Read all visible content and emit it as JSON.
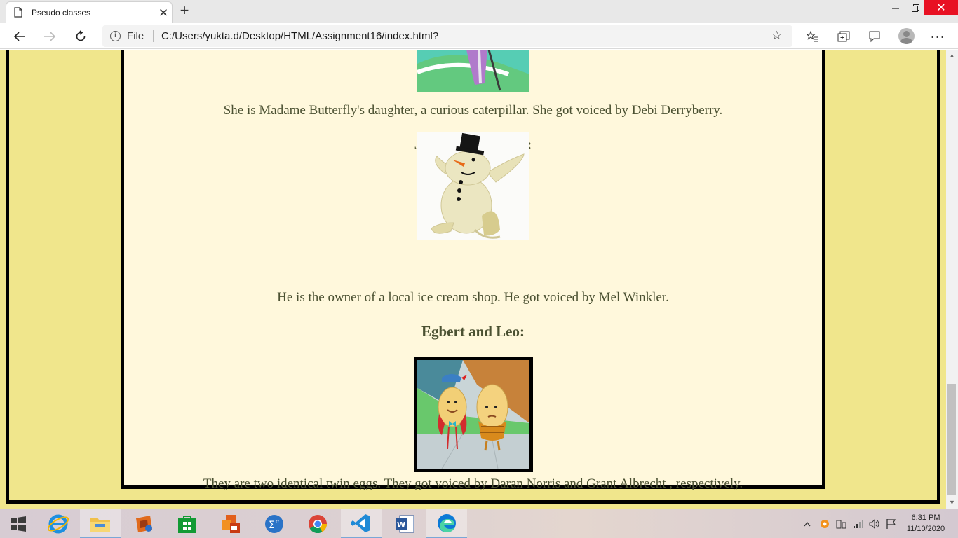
{
  "browser": {
    "tab_title": "Pseudo classes",
    "address_prefix": "File",
    "url": "C:/Users/yukta.d/Desktop/HTML/Assignment16/index.html?"
  },
  "page": {
    "caterpillar_desc": "She is Madame Butterfly's daughter, a curious caterpillar. She got voiced by Debi Derryberry.",
    "snowman_heading": "Johnny Snowman:",
    "snowman_desc": "He is the owner of a local ice cream shop. He got voiced by Mel Winkler.",
    "eggs_heading": "Egbert and Leo:",
    "eggs_desc": "They are two identical twin eggs. They got voiced by Daran Norris and Grant Albrecht , respectively."
  },
  "colors": {
    "page_background": "#f0e68c",
    "content_background": "#fff8dc",
    "text": "#4b5132",
    "border": "#000000"
  },
  "taskbar": {
    "apps": [
      "internet-explorer",
      "file-explorer",
      "media-player",
      "store",
      "office",
      "math-input",
      "chrome",
      "vscode",
      "word",
      "edge"
    ],
    "clock_time": "6:31 PM",
    "clock_date": "11/10/2020"
  }
}
